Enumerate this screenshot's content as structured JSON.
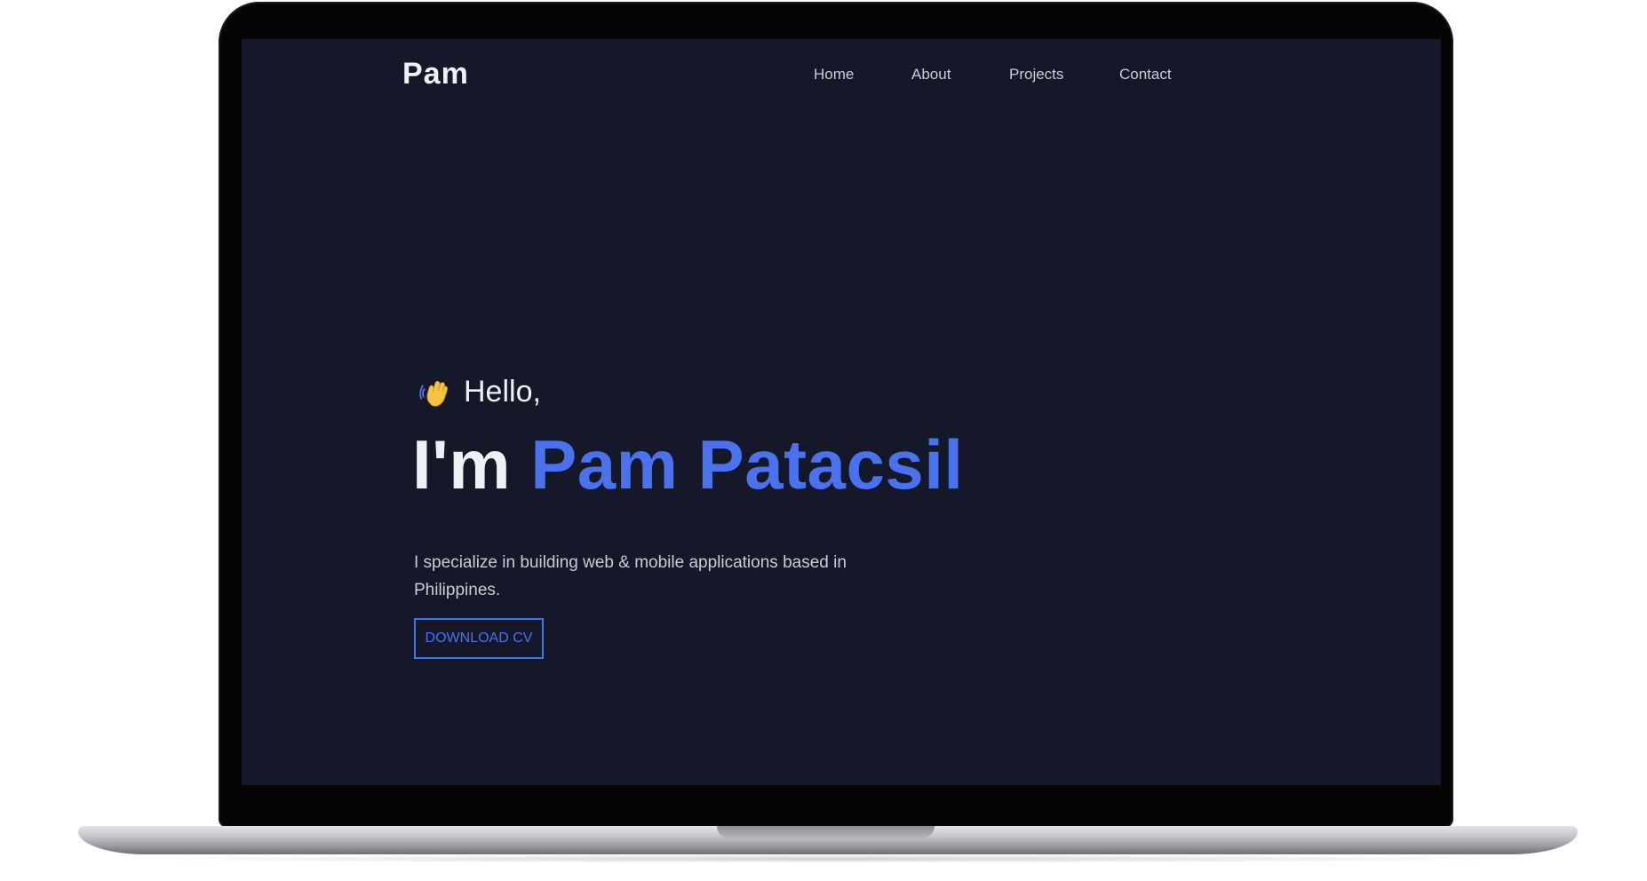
{
  "site": {
    "brand": "Pam"
  },
  "nav": {
    "items": [
      {
        "label": "Home"
      },
      {
        "label": "About"
      },
      {
        "label": "Projects"
      },
      {
        "label": "Contact"
      }
    ]
  },
  "hero": {
    "greeting_icon": "waving-hand-icon",
    "greeting": "Hello,",
    "intro": "I'm",
    "name": "Pam Patacsil",
    "bio": "I specialize in building web & mobile applications based in Philippines.",
    "cta_label": "DOWNLOAD CV"
  },
  "colors": {
    "background": "#151828",
    "accent": "#4a72ef",
    "text": "#eef0f4",
    "muted_text": "#c9ccd6"
  }
}
